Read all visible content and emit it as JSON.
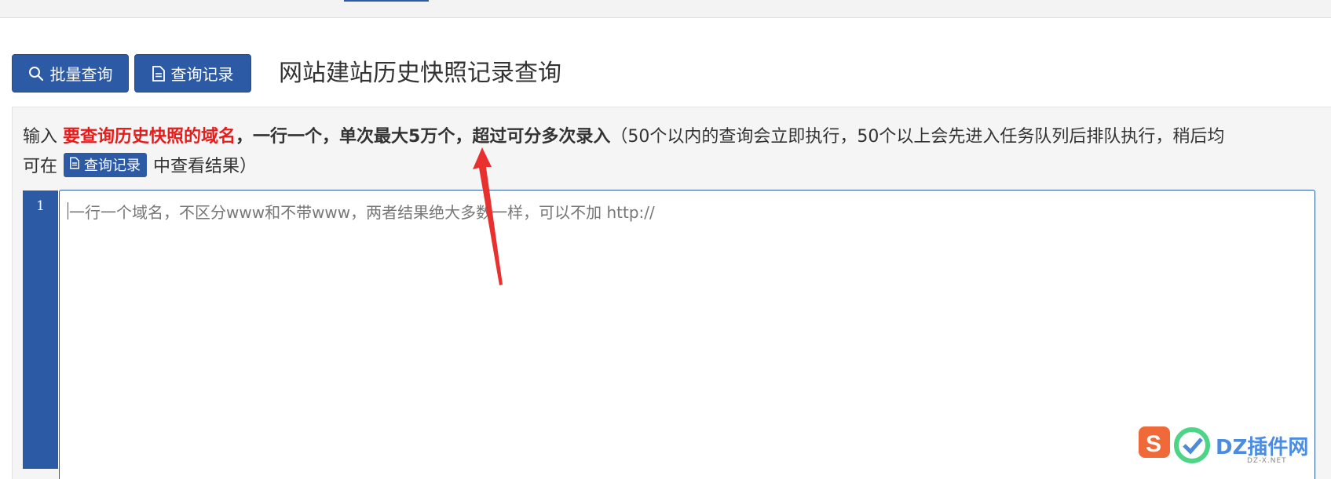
{
  "toolbar": {
    "batch_label": "批量查询",
    "records_label": "查询记录"
  },
  "page": {
    "title": "网站建站历史快照记录查询"
  },
  "instructions": {
    "prefix": "输入 ",
    "highlight": "要查询历史快照的域名",
    "bold_text": "，一行一个，单次最大5万个，超过可分多次录入",
    "note": "（50个以内的查询会立即执行，50个以上会先进入任务队列后排队执行，稍后均",
    "line2_prefix": "可在",
    "line2_link": "查询记录",
    "line2_suffix": "中查看结果）"
  },
  "editor": {
    "line_number": "1",
    "placeholder": "一行一个域名，不区分www和不带www，两者结果绝大多数一样，可以不加 http://"
  },
  "watermark": {
    "text": "DZ插件网",
    "sub": "DZ-X.NET"
  },
  "icons": {
    "search": "search-icon",
    "document": "document-icon"
  },
  "colors": {
    "primary": "#2c5aa5",
    "highlight": "#e81b1b",
    "arrow": "#e8312f"
  }
}
